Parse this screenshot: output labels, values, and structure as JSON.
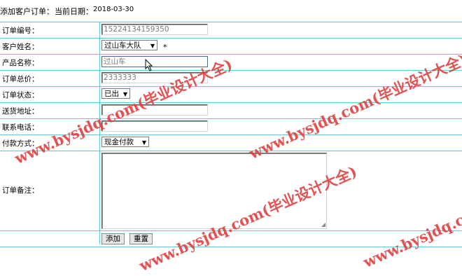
{
  "header": {
    "title": "添加客户订单：",
    "date_label": "当前日期：",
    "date_value": "2018-03-30"
  },
  "form": {
    "order_no": {
      "label": "订单编号：",
      "value": "15224134159350"
    },
    "customer": {
      "label": "客户姓名：",
      "value": "过山车大队",
      "required_mark": "*"
    },
    "product": {
      "label": "产品名称：",
      "value": "过山车"
    },
    "total": {
      "label": "订单总价：",
      "value": "2333333"
    },
    "status": {
      "label": "订单状态：",
      "value": "已出"
    },
    "address": {
      "label": "送货地址：",
      "value": ""
    },
    "phone": {
      "label": "联系电话：",
      "value": ""
    },
    "payment": {
      "label": "付款方式：",
      "value": "现金付款"
    },
    "remark": {
      "label": "订单备注：",
      "value": ""
    }
  },
  "buttons": {
    "add": "添加",
    "reset": "重置"
  },
  "watermark": {
    "text": "www.bysjdq.com(毕业设计大全)",
    "color": "#e04040"
  },
  "colors": {
    "grid_line": "#5fcdd3"
  }
}
